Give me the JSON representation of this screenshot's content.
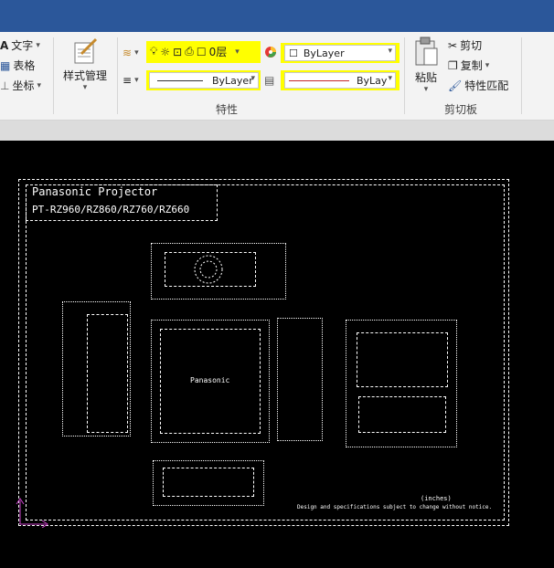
{
  "ribbon": {
    "annotation": {
      "text_label": "文字",
      "table_label": "表格",
      "coord_label": "坐标"
    },
    "style_manager_label": "样式管理",
    "layer": {
      "layer_value": "0层",
      "color_value": "ByLayer",
      "linetype_value": "ByLayer",
      "lineweight_value": "ByLay"
    },
    "properties_group_label": "特性",
    "clipboard": {
      "paste_label": "粘贴",
      "cut_label": "剪切",
      "copy_label": "复制",
      "match_label": "特性匹配",
      "group_label": "剪切板"
    }
  },
  "drawing": {
    "title_line1": "Panasonic Projector",
    "title_line2": "PT-RZ960/RZ860/RZ760/RZ660",
    "brand_text": "Panasonic",
    "note_unit": "(inches)",
    "note_text": "Design and specifications subject to change without notice."
  },
  "colors": {
    "titlebar": "#2b579a",
    "highlight": "#ffff00",
    "canvas": "#000000",
    "ucs": "#cc44cc"
  }
}
